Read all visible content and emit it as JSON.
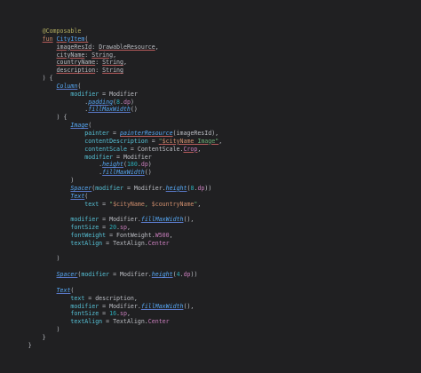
{
  "editor": {
    "lines": [
      [
        {
          "t": "            "
        },
        {
          "t": "@Composable",
          "c": "tok-ann"
        }
      ],
      [
        {
          "t": "            "
        },
        {
          "t": "fun",
          "c": "tok-kw u-red"
        },
        {
          "t": " "
        },
        {
          "t": "CityItem",
          "c": "tok-fn u-red"
        },
        {
          "t": "(",
          "c": "u-red"
        }
      ],
      [
        {
          "t": "                "
        },
        {
          "t": "imageResId",
          "c": "tok-param u-red"
        },
        {
          "t": ": "
        },
        {
          "t": "DrawableResource",
          "c": "tok-type u-red"
        },
        {
          "t": ","
        }
      ],
      [
        {
          "t": "                "
        },
        {
          "t": "cityName",
          "c": "tok-param u-red"
        },
        {
          "t": ": "
        },
        {
          "t": "String",
          "c": "tok-type u-red"
        },
        {
          "t": ","
        }
      ],
      [
        {
          "t": "                "
        },
        {
          "t": "countryName",
          "c": "tok-param u-red"
        },
        {
          "t": ": "
        },
        {
          "t": "String",
          "c": "tok-type u-red"
        },
        {
          "t": ","
        }
      ],
      [
        {
          "t": "                "
        },
        {
          "t": "description",
          "c": "tok-param u-red"
        },
        {
          "t": ": "
        },
        {
          "t": "String",
          "c": "tok-type u-red"
        }
      ],
      [
        {
          "t": "            "
        },
        {
          "t": ") {"
        }
      ],
      [
        {
          "t": "                "
        },
        {
          "t": "Column",
          "c": "tok-call u-blue"
        },
        {
          "t": "("
        }
      ],
      [
        {
          "t": "                    "
        },
        {
          "t": "modifier",
          "c": "tok-named"
        },
        {
          "t": " = "
        },
        {
          "t": "Modifier",
          "c": "tok-type"
        }
      ],
      [
        {
          "t": "                        ."
        },
        {
          "t": "padding",
          "c": "tok-ext u-blue"
        },
        {
          "t": "("
        },
        {
          "t": "8",
          "c": "tok-num"
        },
        {
          "t": "."
        },
        {
          "t": "dp",
          "c": "tok-prop"
        },
        {
          "t": ")"
        }
      ],
      [
        {
          "t": "                        ."
        },
        {
          "t": "fillMaxWidth",
          "c": "tok-ext u-blue"
        },
        {
          "t": "()"
        }
      ],
      [
        {
          "t": "                ) {"
        }
      ],
      [
        {
          "t": "                    "
        },
        {
          "t": "Image",
          "c": "tok-call u-blue"
        },
        {
          "t": "("
        }
      ],
      [
        {
          "t": "                        "
        },
        {
          "t": "painter",
          "c": "tok-named"
        },
        {
          "t": " = "
        },
        {
          "t": "painterResource",
          "c": "tok-call u-red"
        },
        {
          "t": "(imageResId),"
        }
      ],
      [
        {
          "t": "                        "
        },
        {
          "t": "contentDescription",
          "c": "tok-named"
        },
        {
          "t": " = "
        },
        {
          "t": "\"",
          "c": "tok-str u-red"
        },
        {
          "t": "$cityName",
          "c": "tok-interp u-red"
        },
        {
          "t": " Image\"",
          "c": "tok-str u-red"
        },
        {
          "t": ","
        }
      ],
      [
        {
          "t": "                        "
        },
        {
          "t": "contentScale",
          "c": "tok-named"
        },
        {
          "t": " = "
        },
        {
          "t": "ContentScale",
          "c": "tok-type"
        },
        {
          "t": "."
        },
        {
          "t": "Crop",
          "c": "tok-prop u-red"
        },
        {
          "t": ","
        }
      ],
      [
        {
          "t": "                        "
        },
        {
          "t": "modifier",
          "c": "tok-named"
        },
        {
          "t": " = "
        },
        {
          "t": "Modifier",
          "c": "tok-type"
        }
      ],
      [
        {
          "t": "                            ."
        },
        {
          "t": "height",
          "c": "tok-ext u-blue"
        },
        {
          "t": "("
        },
        {
          "t": "180",
          "c": "tok-num"
        },
        {
          "t": "."
        },
        {
          "t": "dp",
          "c": "tok-prop"
        },
        {
          "t": ")"
        }
      ],
      [
        {
          "t": "                            ."
        },
        {
          "t": "fillMaxWidth",
          "c": "tok-ext u-blue"
        },
        {
          "t": "()"
        }
      ],
      [
        {
          "t": "                    )"
        }
      ],
      [
        {
          "t": "                    "
        },
        {
          "t": "Spacer",
          "c": "tok-call u-blue"
        },
        {
          "t": "("
        },
        {
          "t": "modifier",
          "c": "tok-named"
        },
        {
          "t": " = "
        },
        {
          "t": "Modifier",
          "c": "tok-type"
        },
        {
          "t": "."
        },
        {
          "t": "height",
          "c": "tok-ext u-blue"
        },
        {
          "t": "("
        },
        {
          "t": "8",
          "c": "tok-num"
        },
        {
          "t": "."
        },
        {
          "t": "dp",
          "c": "tok-prop"
        },
        {
          "t": "))"
        }
      ],
      [
        {
          "t": "                    "
        },
        {
          "t": "Text",
          "c": "tok-call u-blue"
        },
        {
          "t": "("
        }
      ],
      [
        {
          "t": "                        "
        },
        {
          "t": "text",
          "c": "tok-named"
        },
        {
          "t": " = "
        },
        {
          "t": "\"",
          "c": "tok-str"
        },
        {
          "t": "$cityName",
          "c": "tok-interp"
        },
        {
          "t": ", ",
          "c": "tok-str"
        },
        {
          "t": "$countryName",
          "c": "tok-interp"
        },
        {
          "t": "\"",
          "c": "tok-str"
        },
        {
          "t": ","
        }
      ],
      [
        {
          "t": ""
        }
      ],
      [
        {
          "t": "                    "
        },
        {
          "t": "modifier",
          "c": "tok-named"
        },
        {
          "t": " = "
        },
        {
          "t": "Modifier",
          "c": "tok-type"
        },
        {
          "t": "."
        },
        {
          "t": "fillMaxWidth",
          "c": "tok-ext u-blue"
        },
        {
          "t": "(),"
        }
      ],
      [
        {
          "t": "                    "
        },
        {
          "t": "fontSize",
          "c": "tok-named"
        },
        {
          "t": " = "
        },
        {
          "t": "20",
          "c": "tok-num"
        },
        {
          "t": "."
        },
        {
          "t": "sp",
          "c": "tok-prop"
        },
        {
          "t": ","
        }
      ],
      [
        {
          "t": "                    "
        },
        {
          "t": "fontWeight",
          "c": "tok-named"
        },
        {
          "t": " = "
        },
        {
          "t": "FontWeight",
          "c": "tok-type"
        },
        {
          "t": "."
        },
        {
          "t": "W500",
          "c": "tok-prop"
        },
        {
          "t": ","
        }
      ],
      [
        {
          "t": "                    "
        },
        {
          "t": "textAlign",
          "c": "tok-named"
        },
        {
          "t": " = "
        },
        {
          "t": "TextAlign",
          "c": "tok-type"
        },
        {
          "t": "."
        },
        {
          "t": "Center",
          "c": "tok-prop"
        }
      ],
      [
        {
          "t": ""
        }
      ],
      [
        {
          "t": "                )"
        }
      ],
      [
        {
          "t": ""
        }
      ],
      [
        {
          "t": "                "
        },
        {
          "t": "Spacer",
          "c": "tok-call u-blue"
        },
        {
          "t": "("
        },
        {
          "t": "modifier",
          "c": "tok-named"
        },
        {
          "t": " = "
        },
        {
          "t": "Modifier",
          "c": "tok-type"
        },
        {
          "t": "."
        },
        {
          "t": "height",
          "c": "tok-ext u-blue"
        },
        {
          "t": "("
        },
        {
          "t": "4",
          "c": "tok-num"
        },
        {
          "t": "."
        },
        {
          "t": "dp",
          "c": "tok-prop"
        },
        {
          "t": "))"
        }
      ],
      [
        {
          "t": ""
        }
      ],
      [
        {
          "t": "                "
        },
        {
          "t": "Text",
          "c": "tok-call u-blue"
        },
        {
          "t": "("
        }
      ],
      [
        {
          "t": "                    "
        },
        {
          "t": "text",
          "c": "tok-named"
        },
        {
          "t": " = description,"
        }
      ],
      [
        {
          "t": "                    "
        },
        {
          "t": "modifier",
          "c": "tok-named"
        },
        {
          "t": " = "
        },
        {
          "t": "Modifier",
          "c": "tok-type"
        },
        {
          "t": "."
        },
        {
          "t": "fillMaxWidth",
          "c": "tok-ext u-blue"
        },
        {
          "t": "(),"
        }
      ],
      [
        {
          "t": "                    "
        },
        {
          "t": "fontSize",
          "c": "tok-named"
        },
        {
          "t": " = "
        },
        {
          "t": "16",
          "c": "tok-num"
        },
        {
          "t": "."
        },
        {
          "t": "sp",
          "c": "tok-prop"
        },
        {
          "t": ","
        }
      ],
      [
        {
          "t": "                    "
        },
        {
          "t": "textAlign",
          "c": "tok-named"
        },
        {
          "t": " = "
        },
        {
          "t": "TextAlign",
          "c": "tok-type"
        },
        {
          "t": "."
        },
        {
          "t": "Center",
          "c": "tok-prop"
        }
      ],
      [
        {
          "t": "                )"
        }
      ],
      [
        {
          "t": "            }"
        }
      ],
      [
        {
          "t": "        }"
        }
      ]
    ]
  }
}
